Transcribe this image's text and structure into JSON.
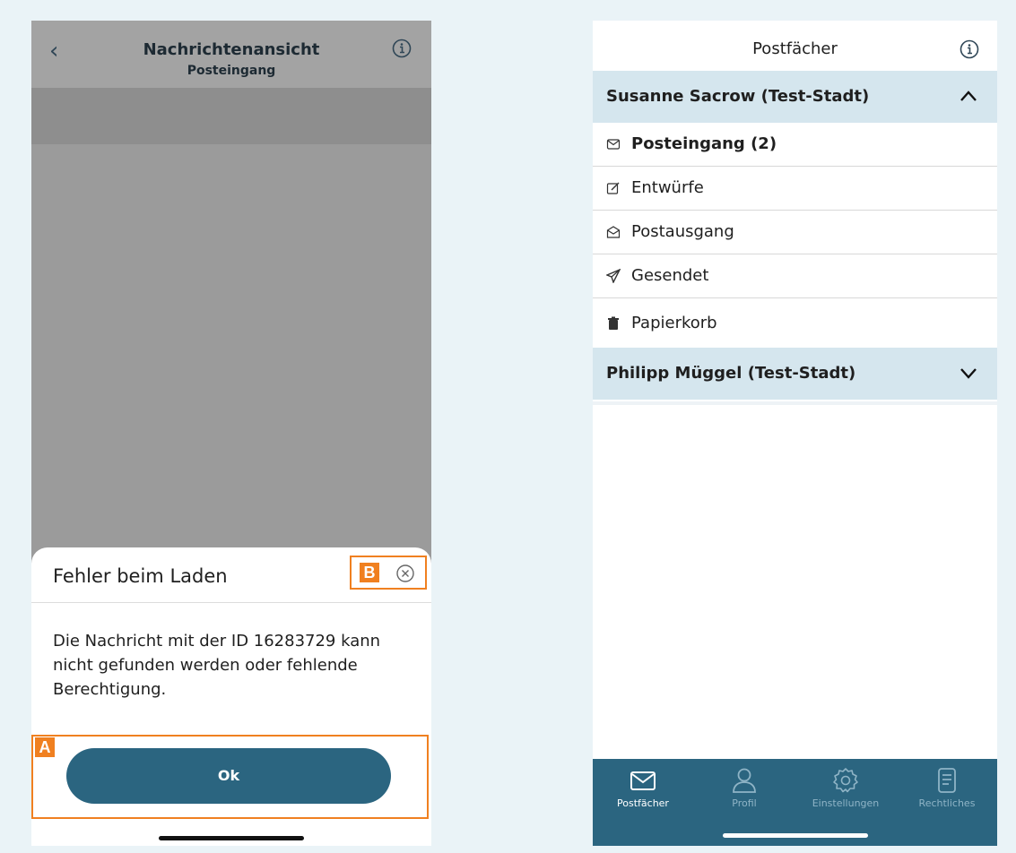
{
  "left": {
    "header": {
      "title": "Nachrichtenansicht",
      "subtitle": "Posteingang"
    },
    "dialog": {
      "title": "Fehler beim Laden",
      "message": "Die Nachricht mit der ID 16283729 kann nicht gefunden werden oder fehlende Berechtigung.",
      "ok_label": "Ok",
      "annotation_a": "A",
      "annotation_b": "B"
    }
  },
  "right": {
    "title": "Postfächer",
    "accounts": [
      {
        "name": "Susanne Sacrow (Test-Stadt)",
        "expanded": true,
        "folders": [
          {
            "label": "Posteingang (2)",
            "icon": "inbox-icon",
            "bold": true
          },
          {
            "label": "Entwürfe",
            "icon": "drafts-icon"
          },
          {
            "label": "Postausgang",
            "icon": "outbox-icon"
          },
          {
            "label": "Gesendet",
            "icon": "sent-icon"
          },
          {
            "label": "Papierkorb",
            "icon": "trash-icon"
          }
        ]
      },
      {
        "name": "Philipp Müggel (Test-Stadt)",
        "expanded": false
      }
    ],
    "tabs": [
      {
        "label": "Postfächer",
        "icon": "mail-icon",
        "active": true
      },
      {
        "label": "Profil",
        "icon": "user-icon"
      },
      {
        "label": "Einstellungen",
        "icon": "gear-icon"
      },
      {
        "label": "Rechtliches",
        "icon": "document-icon"
      }
    ]
  },
  "colors": {
    "accent": "#2b6580",
    "annotation": "#f08020",
    "account_header": "#d5e6ee",
    "overlay": "#9b9b9b"
  }
}
